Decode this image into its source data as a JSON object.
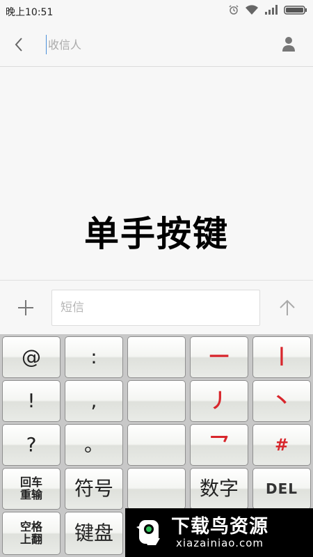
{
  "status_bar": {
    "time": "晚上10:51"
  },
  "header": {
    "recipient_placeholder": "收信人"
  },
  "message_area": {
    "overlay_title": "单手按键"
  },
  "compose": {
    "sms_placeholder": "短信"
  },
  "keyboard": {
    "rows": [
      [
        "@",
        ":",
        "",
        "一",
        "丨"
      ],
      [
        "!",
        ",",
        "",
        "丿",
        "丶"
      ],
      [
        "?",
        "。",
        "",
        "乛",
        "#"
      ],
      [
        "回车\n重输",
        "符号",
        "",
        "数字",
        "DEL"
      ],
      [
        "空格\n上翻",
        "键盘",
        "",
        "",
        ""
      ]
    ]
  },
  "watermark": {
    "brand_cn": "下载鸟资源",
    "brand_url": "xiazainiao.com"
  },
  "colors": {
    "stroke_red": "#d8262c",
    "background": "#f7f7f7",
    "keyboard_bg": "#c8c8c8"
  }
}
